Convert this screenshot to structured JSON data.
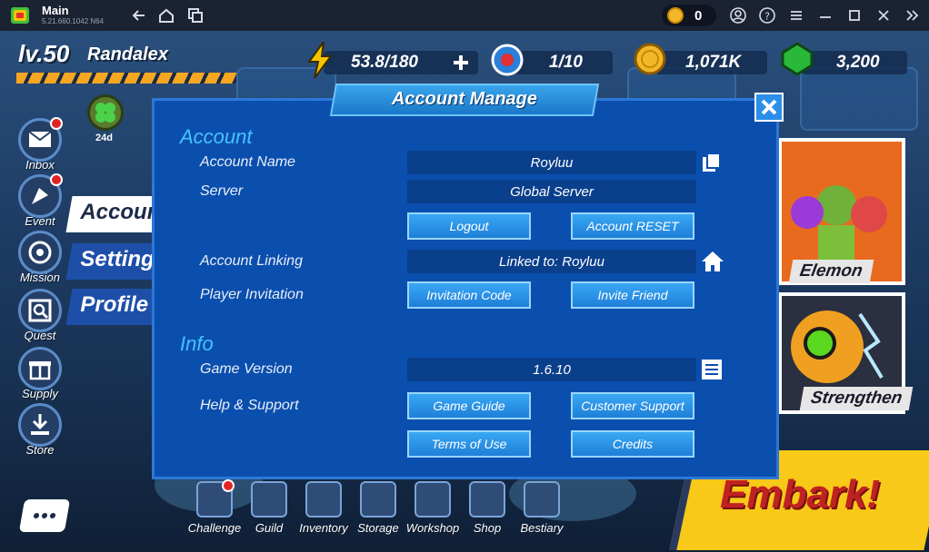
{
  "emulator": {
    "title": "Main",
    "version": "5.21.660.1042 N64",
    "coin_count": "0"
  },
  "player": {
    "level": "lv.50",
    "name": "Randalex"
  },
  "resources": {
    "energy": "53.8/180",
    "tickets": "1/10",
    "gold": "1,071K",
    "gems": "3,200"
  },
  "badge": {
    "label": "24d"
  },
  "sidebar": {
    "items": [
      {
        "label": "Inbox"
      },
      {
        "label": "Event"
      },
      {
        "label": "Mission"
      },
      {
        "label": "Quest"
      },
      {
        "label": "Supply"
      },
      {
        "label": "Store"
      }
    ]
  },
  "tabs": {
    "account": "Account",
    "setting": "Setting",
    "profile": "Profile"
  },
  "modal": {
    "title": "Account Manage",
    "account_section": "Account",
    "account_name_label": "Account Name",
    "account_name_value": "Royluu",
    "server_label": "Server",
    "server_value": "Global Server",
    "logout": "Logout",
    "account_reset": "Account RESET",
    "linking_label": "Account Linking",
    "linking_value": "Linked to: Royluu",
    "invitation_label": "Player Invitation",
    "invitation_code": "Invitation Code",
    "invite_friend": "Invite Friend",
    "info_section": "Info",
    "version_label": "Game Version",
    "version_value": "1.6.10",
    "help_label": "Help & Support",
    "game_guide": "Game Guide",
    "customer_support": "Customer Support",
    "terms": "Terms of Use",
    "credits": "Credits"
  },
  "cards": {
    "elemon": "Elemon",
    "strengthen": "Strengthen"
  },
  "bottom_nav": {
    "items": [
      {
        "label": "Challenge"
      },
      {
        "label": "Guild"
      },
      {
        "label": "Inventory"
      },
      {
        "label": "Storage"
      },
      {
        "label": "Workshop"
      },
      {
        "label": "Shop"
      },
      {
        "label": "Bestiary"
      }
    ]
  },
  "embark": "Embark!",
  "colors": {
    "modal_bg": "#0b4fae",
    "section_title": "#45c2ff",
    "button": "#1e7fd8",
    "embark_bg": "#f8c918",
    "embark_text": "#c02222"
  }
}
